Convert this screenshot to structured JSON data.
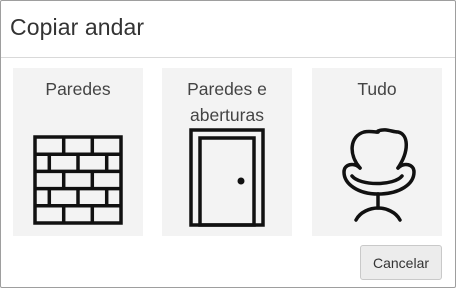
{
  "dialog": {
    "title": "Copiar andar",
    "options": [
      {
        "label": "Paredes",
        "icon": "brick-wall-icon"
      },
      {
        "label_line1": "Paredes e",
        "label_line2": "aberturas",
        "icon": "door-icon"
      },
      {
        "label": "Tudo",
        "icon": "armchair-icon"
      }
    ],
    "cancel_label": "Cancelar"
  }
}
